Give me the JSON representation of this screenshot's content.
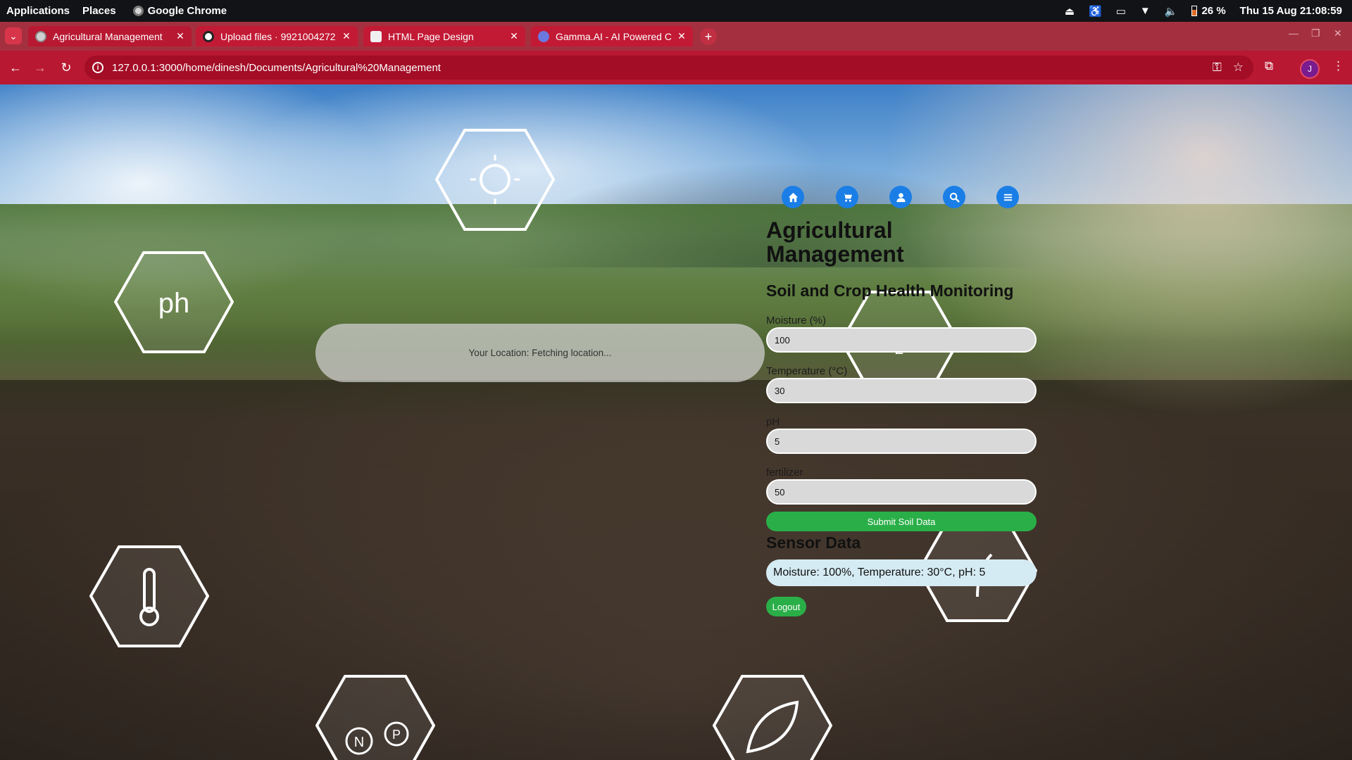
{
  "os": {
    "applications": "Applications",
    "places": "Places",
    "app_name": "Google Chrome",
    "battery": "26 %",
    "datetime": "Thu 15 Aug  21:08:59"
  },
  "browser": {
    "tabs": [
      {
        "title": "Agricultural Management",
        "active": true,
        "favicon": "globe-icon"
      },
      {
        "title": "Upload files · 9921004272",
        "active": false,
        "favicon": "github-icon"
      },
      {
        "title": "HTML Page Design",
        "active": false,
        "favicon": "openai-icon"
      },
      {
        "title": "Gamma.AI - AI Powered C",
        "active": false,
        "favicon": "gamma-icon"
      }
    ],
    "url": "127.0.0.1:3000/home/dinesh/Documents/Agricultural%20Management",
    "profile_initial": "J",
    "theme_color": "#b81831"
  },
  "page": {
    "location": "Your Location: Fetching location...",
    "nav": [
      "home-icon",
      "cart-icon",
      "user-icon",
      "search-icon",
      "menu-icon"
    ],
    "title": "Agricultural Management",
    "subtitle": "Soil and Crop Health Monitoring",
    "fields": {
      "moisture": {
        "label": "Moisture (%)",
        "value": "100"
      },
      "temperature": {
        "label": "Temperature (°C)",
        "value": "30"
      },
      "ph": {
        "label": "pH",
        "value": "5"
      },
      "fertilizer": {
        "label": "fertilizer",
        "value": "50"
      }
    },
    "submit_label": "Submit Soil Data",
    "sensor_title": "Sensor Data",
    "sensor_text": "Moisture: 100%, Temperature: 30°C, pH: 5",
    "logout_label": "Logout",
    "accent_blue": "#1a7ee6",
    "accent_green": "#2aaf48"
  },
  "background": {
    "hex_labels": [
      "ph",
      "H₂O",
      "N",
      "P"
    ]
  }
}
